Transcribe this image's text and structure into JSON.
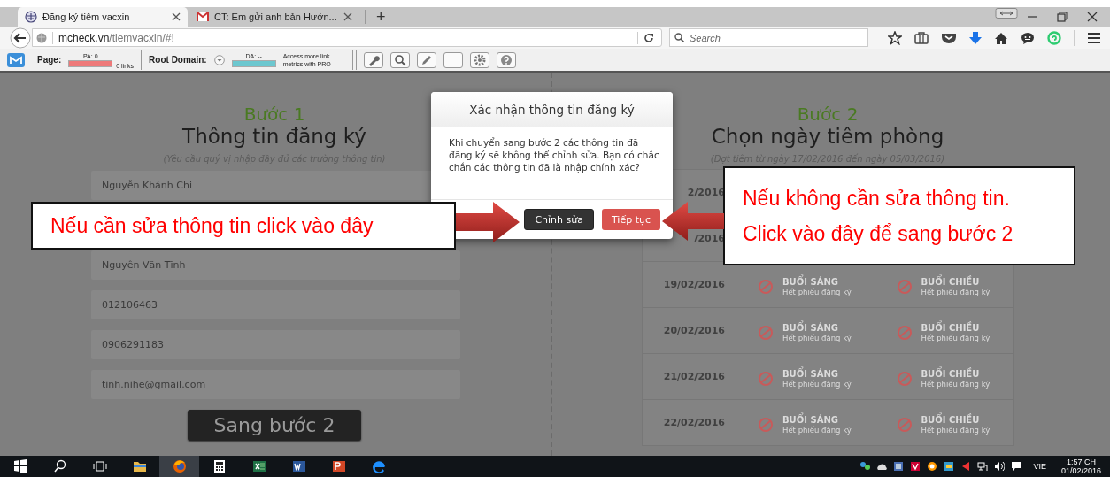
{
  "browser": {
    "tabs": [
      {
        "title": "Đăng ký tiêm vacxin",
        "selected": true
      },
      {
        "title": "CT: Em gửi anh bản Hướn...",
        "selected": false
      }
    ],
    "new_tab": "+",
    "address": {
      "domain": "mcheck.vn",
      "path": "/tiemvacxin/#!"
    },
    "search": {
      "placeholder": "Search"
    }
  },
  "moz_bar": {
    "page_label": "Page:",
    "pa": "PA: 0",
    "links": "0 links",
    "root_domain_label": "Root Domain:",
    "da": "DA: --",
    "promo": "Access more link metrics with PRO"
  },
  "step1": {
    "step": "Bước 1",
    "title": "Thông tin đăng ký",
    "hint": "(Yêu cầu quý vị nhập đầy đủ các trường thông tin)",
    "fields": [
      {
        "value": "Nguyễn Khánh Chi"
      },
      {
        "value": "Nguyên Văn Tĩnh"
      },
      {
        "value": "012106463"
      },
      {
        "value": "0906291183"
      },
      {
        "value": "tinh.nihe@gmail.com"
      }
    ],
    "submit": "Sang bước 2"
  },
  "step2": {
    "step": "Bước 2",
    "title": "Chọn ngày tiêm phòng",
    "hint": "(Đợt tiêm từ ngày 17/02/2016 đến ngày 05/03/2016)",
    "rows": [
      {
        "date": "2/2016"
      },
      {
        "date": "/2016"
      },
      {
        "date": "19/02/2016",
        "sessions": [
          {
            "name": "BUỔI SÁNG",
            "status": "Hết phiếu đăng ký"
          },
          {
            "name": "BUỔI CHIỀU",
            "status": "Hết phiếu đăng ký"
          }
        ]
      },
      {
        "date": "20/02/2016",
        "sessions": [
          {
            "name": "BUỔI SÁNG",
            "status": "Hết phiếu đăng ký"
          },
          {
            "name": "BUỔI CHIỀU",
            "status": "Hết phiếu đăng ký"
          }
        ]
      },
      {
        "date": "21/02/2016",
        "sessions": [
          {
            "name": "BUỔI SÁNG",
            "status": "Hết phiếu đăng ký"
          },
          {
            "name": "BUỔI CHIỀU",
            "status": "Hết phiếu đăng ký"
          }
        ]
      },
      {
        "date": "22/02/2016",
        "sessions": [
          {
            "name": "BUỔI SÁNG",
            "status": "Hết phiếu đăng ký"
          },
          {
            "name": "BUỔI CHIỀU",
            "status": "Hết phiếu đăng ký"
          }
        ]
      }
    ]
  },
  "dialog": {
    "title": "Xác nhận thông tin đăng ký",
    "message": "Khi chuyển sang bước 2 các thông tin đã đăng ký sẽ không thể chỉnh sửa. Bạn có chắc chắn các thông tin đã là nhập chính xác?",
    "buttons": [
      {
        "label": "Chỉnh sửa",
        "kind": "dark"
      },
      {
        "label": "Tiếp tục",
        "kind": "danger"
      }
    ]
  },
  "callouts": [
    {
      "lines": [
        "Nếu cần sửa thông tin click vào đây"
      ]
    },
    {
      "lines": [
        "Nếu không cần sửa thông tin.",
        "Click vào đây để sang bước 2"
      ]
    }
  ],
  "taskbar": {
    "language": "VIE",
    "time": "1:57 CH",
    "date": "01/02/2016"
  }
}
